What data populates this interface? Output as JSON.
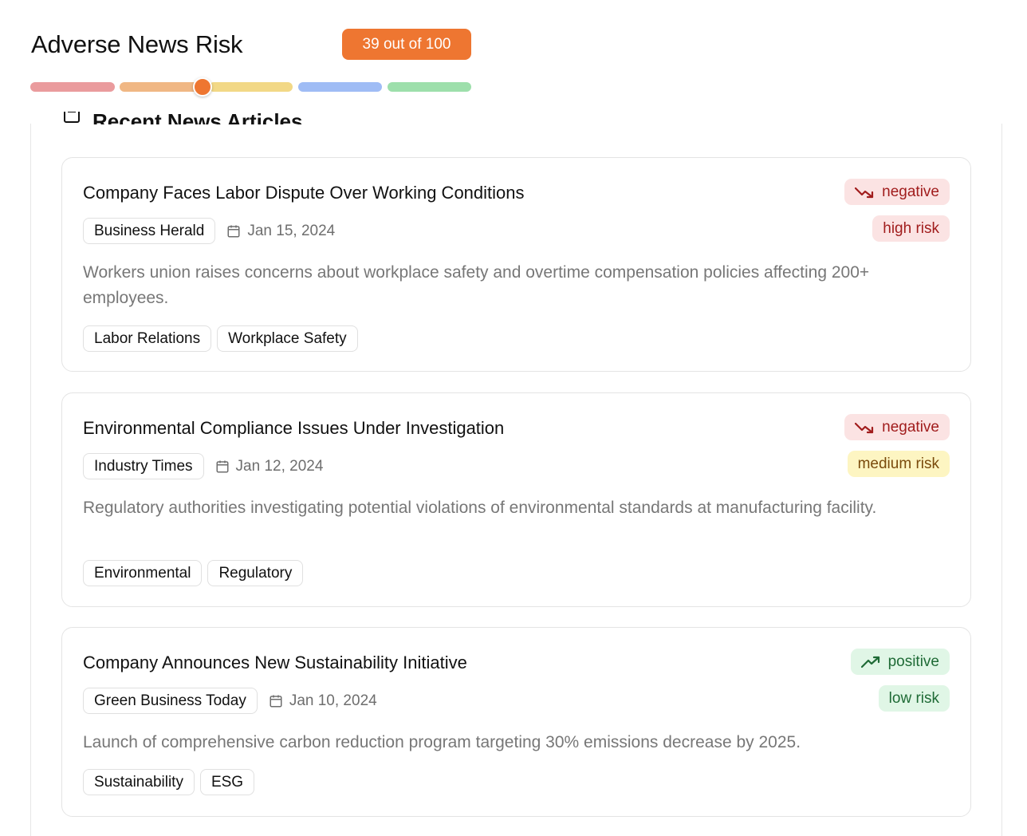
{
  "header": {
    "title": "Adverse News Risk",
    "score_label": "39 out of 100",
    "score": 39,
    "score_max": 100,
    "scale_colors": [
      "#ea9b9d",
      "#f0b784",
      "#f2d886",
      "#9fbcf5",
      "#9ddfab"
    ],
    "marker_color": "#ee7631"
  },
  "section": {
    "heading": "Recent News Articles",
    "icon": "newspaper-icon"
  },
  "articles": [
    {
      "title": "Company Faces Labor Dispute Over Working Conditions",
      "source": "Business Herald",
      "date": "Jan 15, 2024",
      "description": "Workers union raises concerns about workplace safety and overtime compensation policies affecting 200+ employees.",
      "tags": [
        "Labor Relations",
        "Workplace Safety"
      ],
      "sentiment": "negative",
      "sentiment_icon": "trending-down-icon",
      "risk": "high risk",
      "sentiment_bg": "#fbe3e3",
      "sentiment_color": "#a11d1d",
      "risk_bg": "#fbe3e3",
      "risk_color": "#a11d1d"
    },
    {
      "title": "Environmental Compliance Issues Under Investigation",
      "source": "Industry Times",
      "date": "Jan 12, 2024",
      "description": "Regulatory authorities investigating potential violations of environmental standards at manufacturing facility.",
      "tags": [
        "Environmental",
        "Regulatory"
      ],
      "sentiment": "negative",
      "sentiment_icon": "trending-down-icon",
      "risk": "medium risk",
      "sentiment_bg": "#fbe3e3",
      "sentiment_color": "#a11d1d",
      "risk_bg": "#fdf5c2",
      "risk_color": "#7a4b0c"
    },
    {
      "title": "Company Announces New Sustainability Initiative",
      "source": "Green Business Today",
      "date": "Jan 10, 2024",
      "description": "Launch of comprehensive carbon reduction program targeting 30% emissions decrease by 2025.",
      "tags": [
        "Sustainability",
        "ESG"
      ],
      "sentiment": "positive",
      "sentiment_icon": "trending-up-icon",
      "risk": "low risk",
      "sentiment_bg": "#e0f6e6",
      "sentiment_color": "#1f6b36",
      "risk_bg": "#e0f6e6",
      "risk_color": "#1f6b36"
    }
  ]
}
